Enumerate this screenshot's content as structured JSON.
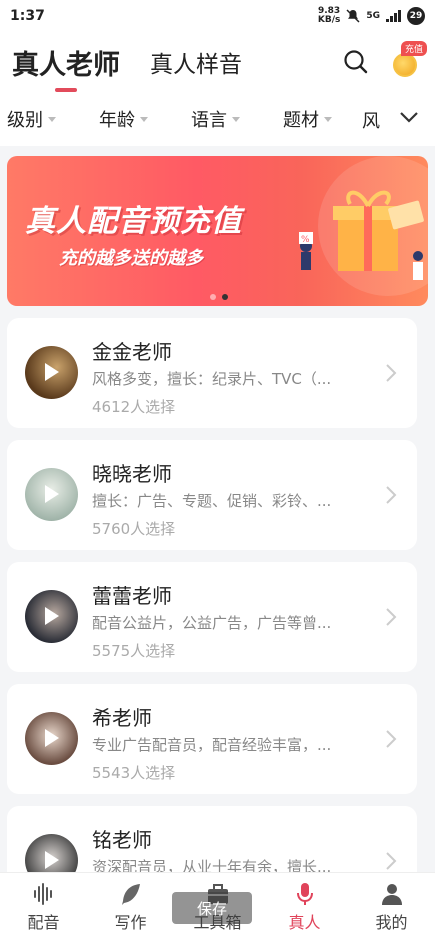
{
  "status": {
    "time": "1:37",
    "speed_top": "9.83",
    "speed_bottom": "KB/s",
    "net": "5G",
    "battery": "29"
  },
  "header": {
    "tab_active": "真人老师",
    "tab_other": "真人样音",
    "recharge_badge": "充值"
  },
  "filters": {
    "items": [
      "级别",
      "年龄",
      "语言",
      "题材"
    ],
    "last": "风"
  },
  "banner": {
    "title": "真人配音预充值",
    "subtitle": "充的越多送的越多"
  },
  "teachers": [
    {
      "name": "金金老师",
      "desc": "风格多变，擅长：纪录片、TVC（...",
      "count": "4612人选择",
      "color": "#5a3a1c"
    },
    {
      "name": "晓晓老师",
      "desc": "擅长：广告、专题、促销、彩铃、...",
      "count": "5760人选择",
      "color": "#b9c6b8"
    },
    {
      "name": "蕾蕾老师",
      "desc": "配音公益片，公益广告，广告等曾...",
      "count": "5575人选择",
      "color": "#3a3d46"
    },
    {
      "name": "希老师",
      "desc": "专业广告配音员，配音经验丰富，...",
      "count": "5543人选择",
      "color": "#8a7368"
    },
    {
      "name": "铭老师",
      "desc": "资深配音员，从业十年有余，擅长...",
      "count": "",
      "color": "#444"
    }
  ],
  "nav": {
    "items": [
      "配音",
      "写作",
      "工具箱",
      "真人",
      "我的"
    ]
  },
  "toast": "保存"
}
